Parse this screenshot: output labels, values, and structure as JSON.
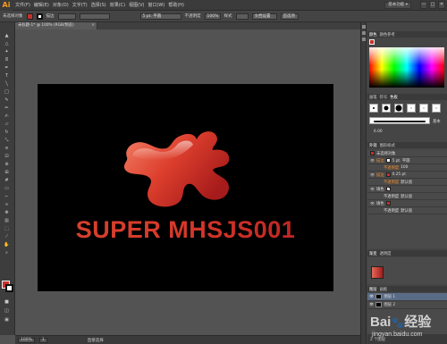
{
  "app": {
    "logo": "Ai",
    "menus": [
      "文件(F)",
      "编辑(E)",
      "对象(O)",
      "文字(T)",
      "选择(S)",
      "效果(C)",
      "视图(V)",
      "窗口(W)",
      "帮助(H)"
    ],
    "right_buttons": [
      "基本功能 ▾",
      "文档设置",
      "首选项"
    ],
    "window_controls": [
      "—",
      "□",
      "✕"
    ]
  },
  "controlbar": {
    "selection_label": "未选择对象",
    "fill_color": "#c8302a",
    "stroke_label": "描边",
    "stroke_value": "",
    "brush_value": "5 pt. 平圆",
    "opacity_label": "不透明度",
    "opacity_value": "100%",
    "style_label": "样式",
    "doc_settings": "文档设置",
    "prefs": "首选项"
  },
  "document": {
    "tab_title": "未标题-1* @ 100% (RGB/预览)",
    "close": "✕"
  },
  "artwork": {
    "headline": "SUPER MHSJS001",
    "shape_colors": [
      "#f07a5e",
      "#d63a2c",
      "#a91b1b"
    ]
  },
  "statusbar": {
    "zoom": "100%",
    "page": "1",
    "tool": "直接选择"
  },
  "panels": {
    "color_tabs": [
      "颜色",
      "颜色参考"
    ],
    "brush_tabs": [
      "画笔",
      "符号",
      "色板"
    ],
    "brush_size": "6.00",
    "brush_option": "基本",
    "appearance_tabs": [
      "外观",
      "图形样式"
    ],
    "appearance_title": "未选择对象",
    "appearance_rows": [
      {
        "name": "描边",
        "value": "5 pt. 平圆"
      },
      {
        "name": "不透明度",
        "value": "100"
      },
      {
        "name": "描边",
        "value": "0.25 pt"
      },
      {
        "name": "不透明度",
        "value": "默认值"
      },
      {
        "name": "填色",
        "value": ""
      },
      {
        "name": "不透明度",
        "value": "默认值"
      },
      {
        "name": "填色",
        "value": ""
      },
      {
        "name": "不透明度",
        "value": "默认值"
      }
    ],
    "gradient_tabs": [
      "渐变",
      "透明度"
    ],
    "layers_tabs": [
      "图层",
      "画板"
    ],
    "layers": [
      {
        "name": "图层 1",
        "selected": true
      },
      {
        "name": "图层 2",
        "selected": false
      }
    ],
    "layers_count": "2 个图层"
  },
  "watermark": {
    "brand": "Bai",
    "brand2": "经验",
    "url": "jingyan.baidu.com"
  }
}
